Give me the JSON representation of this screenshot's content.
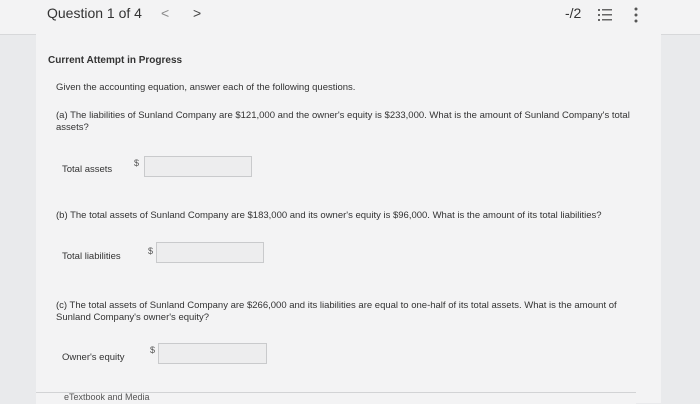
{
  "header": {
    "title": "Question 1 of 4",
    "prev_glyph": "<",
    "next_glyph": ">",
    "score": "-/2"
  },
  "attempt_title": "Current Attempt in Progress",
  "intro": "Given the accounting equation, answer each of the following questions.",
  "part_a": {
    "question": "(a) The liabilities of Sunland Company are $121,000 and the owner's equity is $233,000. What is the amount of Sunland Company's total assets?",
    "label": "Total assets",
    "currency": "$",
    "value": ""
  },
  "part_b": {
    "question": "(b) The total assets of Sunland Company are $183,000 and its owner's equity is $96,000. What is the amount of its total liabilities?",
    "label": "Total liabilities",
    "currency": "$",
    "value": ""
  },
  "part_c": {
    "question": "(c) The total assets of Sunland Company are $266,000 and its liabilities are equal to one-half of its total assets. What is the amount of Sunland Company's owner's equity?",
    "label": "Owner's equity",
    "currency": "$",
    "value": ""
  },
  "footer_label": "eTextbook and Media",
  "icons": {
    "list": "list-icon",
    "more": "more-vertical-icon"
  }
}
